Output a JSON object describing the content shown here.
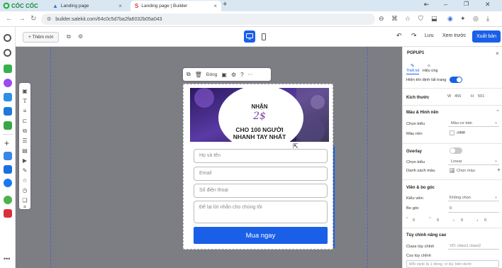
{
  "browser": {
    "brand": "CỐC CỐC",
    "tabs": [
      {
        "label": "Landing page",
        "active": false
      },
      {
        "label": "Landing page | Builder",
        "active": true
      }
    ],
    "url": "builder.salekit.com/64c0c5d7ba2fa6032b05a043"
  },
  "toolbar": {
    "add_label": "+ Thêm mới",
    "save_label": "Lưu",
    "preview_label": "Xem trước",
    "publish_label": "Xuất bản",
    "accent": "#1a5fe8"
  },
  "element_bar": {
    "close_label": "Đóng"
  },
  "popup": {
    "banner": {
      "line1": "NHẬN",
      "line2": "2$",
      "line3": "CHO 100 NGƯỜI",
      "line4": "NHANH TAY NHẤT"
    },
    "fields": {
      "name_placeholder": "Họ và tên",
      "email_placeholder": "Email",
      "phone_placeholder": "Số điện thoại",
      "message_placeholder": "Để lại lời nhắn cho chúng tôi"
    },
    "cta_label": "Mua ngay"
  },
  "panel": {
    "title": "POPUP1",
    "tab_design": "Thiết kế",
    "tab_effect": "Hiệu ứng",
    "show_default_label": "Hiện khi định tất trang",
    "size": {
      "label": "Kích thước",
      "w_label": "W",
      "w_value": "456",
      "h_label": "H",
      "h_value": "501"
    },
    "color_section": "Màu & Hình nền",
    "choose_type_label": "Chọn kiểu",
    "color_type_value": "Màu cơ bản",
    "bg_color_label": "Màu nền",
    "bg_color_value": "#ffffff",
    "overlay_label": "Overlay",
    "overlay_type_label": "Chọn kiểu",
    "overlay_type_value": "Linear",
    "color_list_label": "Danh sách màu",
    "color_pick_label": "Chọn màu",
    "border_section": "Viền & bo góc",
    "border_type_label": "Kiểu viền",
    "border_type_value": "Không chọn",
    "radius_label": "Bo góc",
    "radius_value": "0",
    "corners": [
      "0",
      "0",
      "0",
      "0"
    ],
    "advanced_section": "Tùy chỉnh nâng cao",
    "class_label": "Class tùy chỉnh",
    "class_placeholder": "VD: class1 class2",
    "css_label": "Css tùy chỉnh",
    "css_placeholder": "Mỗi style là 1 dòng, ví dụ: bên dưới"
  }
}
